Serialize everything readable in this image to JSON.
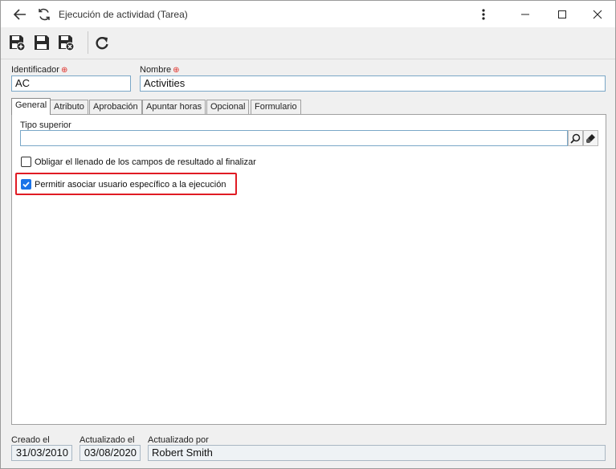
{
  "window": {
    "title": "Ejecución de actividad (Tarea)",
    "back_icon": "arrow-left-icon",
    "refresh_icon": "refresh-icon",
    "menu_icon": "kebab-menu-icon",
    "minimize_icon": "minimize-icon",
    "maximize_icon": "maximize-icon",
    "close_icon": "close-icon"
  },
  "toolbar": {
    "buttons": [
      "save-new-icon",
      "save-icon",
      "save-close-icon",
      "reload-icon"
    ]
  },
  "form": {
    "identificador": {
      "label": "Identificador",
      "value": "AC"
    },
    "nombre": {
      "label": "Nombre",
      "value": "Activities"
    },
    "required_marker": "⊕"
  },
  "tabs": [
    "General",
    "Atributo",
    "Aprobación",
    "Apuntar horas",
    "Opcional",
    "Formulario"
  ],
  "general": {
    "tipo_superior": {
      "label": "Tipo superior",
      "value": ""
    },
    "check1": {
      "label": "Obligar el llenado de los campos de resultado al finalizar",
      "checked": false
    },
    "check2": {
      "label": "Permitir asociar usuario específico a la ejecución",
      "checked": true
    }
  },
  "footer": {
    "creado": {
      "label": "Creado el",
      "value": "31/03/2010"
    },
    "actualizado": {
      "label": "Actualizado el",
      "value": "03/08/2020"
    },
    "actualizado_por": {
      "label": "Actualizado por",
      "value": "Robert Smith"
    }
  },
  "colors": {
    "accent": "#1a73e8",
    "highlight": "#e01b24",
    "required": "#e0302a"
  }
}
